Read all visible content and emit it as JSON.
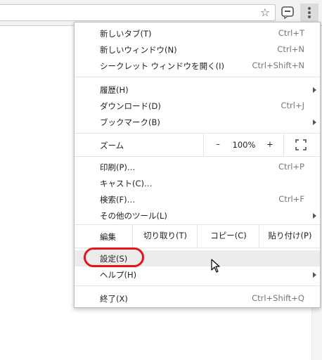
{
  "toolbar": {
    "bookmark_icon": "star-icon",
    "extension_icon": "chat-bubble-icon",
    "menu_icon": "vertical-dots-icon"
  },
  "menu": {
    "new_tab": {
      "label": "新しいタブ(T)",
      "shortcut": "Ctrl+T"
    },
    "new_window": {
      "label": "新しいウィンドウ(N)",
      "shortcut": "Ctrl+N"
    },
    "incognito": {
      "label": "シークレット ウィンドウを開く(I)",
      "shortcut": "Ctrl+Shift+N"
    },
    "history": {
      "label": "履歴(H)"
    },
    "downloads": {
      "label": "ダウンロード(D)",
      "shortcut": "Ctrl+J"
    },
    "bookmarks": {
      "label": "ブックマーク(B)"
    },
    "zoom": {
      "label": "ズーム",
      "minus": "–",
      "value": "100%",
      "plus": "+"
    },
    "print": {
      "label": "印刷(P)…",
      "shortcut": "Ctrl+P"
    },
    "cast": {
      "label": "キャスト(C)…"
    },
    "find": {
      "label": "検索(F)…",
      "shortcut": "Ctrl+F"
    },
    "more_tools": {
      "label": "その他のツール(L)"
    },
    "edit": {
      "label": "編集",
      "cut": "切り取り(T)",
      "copy": "コピー(C)",
      "paste": "貼り付け(P)"
    },
    "settings": {
      "label": "設定(S)"
    },
    "help": {
      "label": "ヘルプ(H)"
    },
    "exit": {
      "label": "終了(X)",
      "shortcut": "Ctrl+Shift+Q"
    }
  },
  "colors": {
    "highlight_circle": "#e8121a",
    "hover_row": "#ececec"
  }
}
